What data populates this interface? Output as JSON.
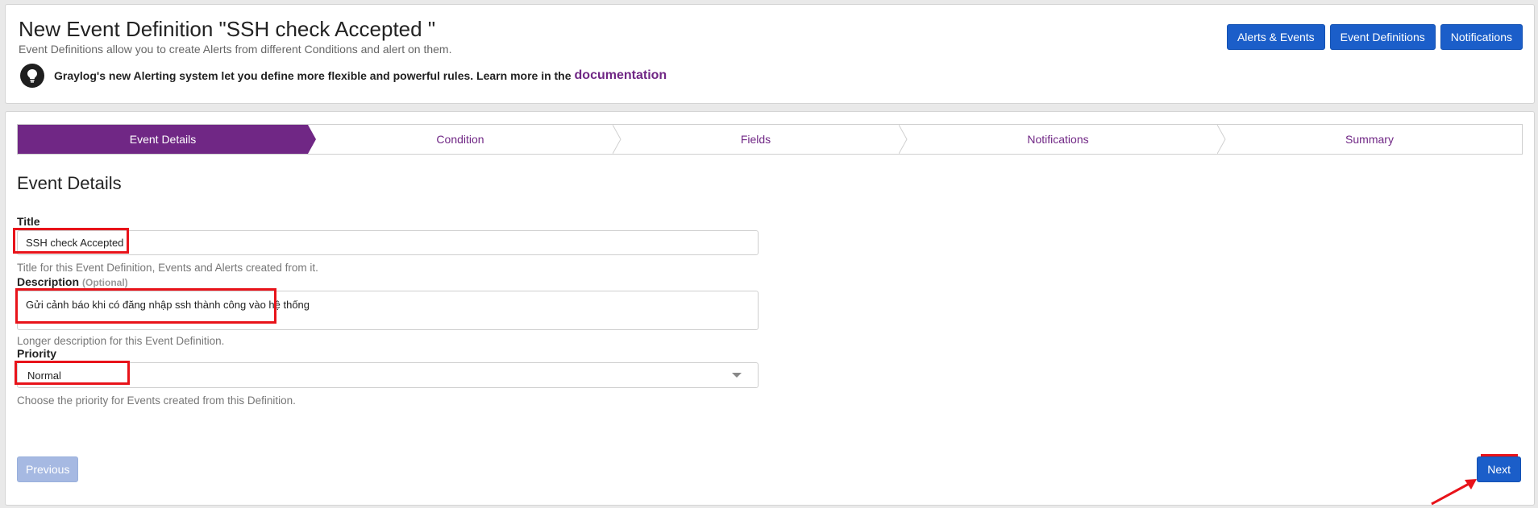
{
  "header": {
    "title": "New Event Definition \"SSH check Accepted \"",
    "subtitle": "Event Definitions allow you to create Alerts from different Conditions and alert on them.",
    "tip_text": "Graylog's new Alerting system let you define more flexible and powerful rules. Learn more in the",
    "tip_link": "documentation",
    "buttons": [
      "Alerts & Events",
      "Event Definitions",
      "Notifications"
    ]
  },
  "steps": [
    {
      "label": "Event Details",
      "active": true
    },
    {
      "label": "Condition",
      "active": false
    },
    {
      "label": "Fields",
      "active": false
    },
    {
      "label": "Notifications",
      "active": false
    },
    {
      "label": "Summary",
      "active": false
    }
  ],
  "form": {
    "section_title": "Event Details",
    "title_label": "Title",
    "title_value": "SSH check Accepted",
    "title_help": "Title for this Event Definition, Events and Alerts created from it.",
    "description_label": "Description",
    "description_optional": "(Optional)",
    "description_value": "Gửi cảnh báo khi có đăng nhập ssh thành công vào hệ thống",
    "description_help": "Longer description for this Event Definition.",
    "priority_label": "Priority",
    "priority_value": "Normal",
    "priority_help": "Choose the priority for Events created from this Definition."
  },
  "footer": {
    "previous_label": "Previous",
    "next_label": "Next"
  },
  "colors": {
    "accent_purple": "#702785",
    "button_blue": "#1b5ec9",
    "highlight_red": "#e8131a"
  },
  "icons": [
    "lightbulb-icon",
    "select-caret-icon",
    "red-arrow-icon"
  ]
}
